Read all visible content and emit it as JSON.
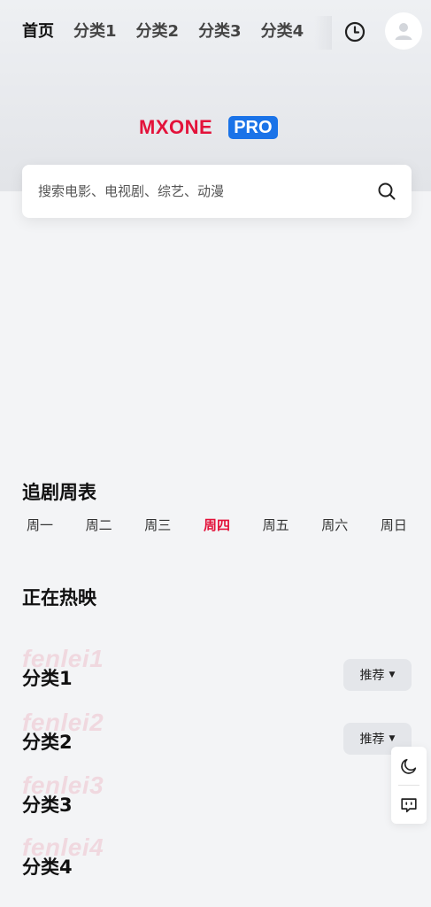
{
  "nav": {
    "tabs": [
      {
        "label": "首页",
        "active": true
      },
      {
        "label": "分类1",
        "active": false
      },
      {
        "label": "分类2",
        "active": false
      },
      {
        "label": "分类3",
        "active": false
      },
      {
        "label": "分类4",
        "active": false
      }
    ],
    "icons": {
      "history": "clock-icon",
      "avatar": "user-icon"
    }
  },
  "logo": {
    "main": "MXONE",
    "badge": "PRO"
  },
  "search": {
    "placeholder": "搜索电影、电视剧、综艺、动漫",
    "value": "",
    "icon": "search-icon"
  },
  "schedule": {
    "title": "追剧周表",
    "days": [
      "周一",
      "周二",
      "周三",
      "周四",
      "周五",
      "周六",
      "周日"
    ],
    "active_day": "周四"
  },
  "now_showing": {
    "title": "正在热映"
  },
  "categories": [
    {
      "title": "分类1",
      "ghost": "fenlei1",
      "pill": "推荐"
    },
    {
      "title": "分类2",
      "ghost": "fenlei2",
      "pill": "推荐"
    },
    {
      "title": "分类3",
      "ghost": "fenlei3",
      "pill": ""
    },
    {
      "title": "分类4",
      "ghost": "fenlei4",
      "pill": ""
    }
  ],
  "float_tools": {
    "icons": [
      "moon-icon",
      "feedback-icon"
    ]
  },
  "colors": {
    "accent": "#e3123a",
    "badge": "#1a73e8",
    "highlight": "#f6c945"
  }
}
